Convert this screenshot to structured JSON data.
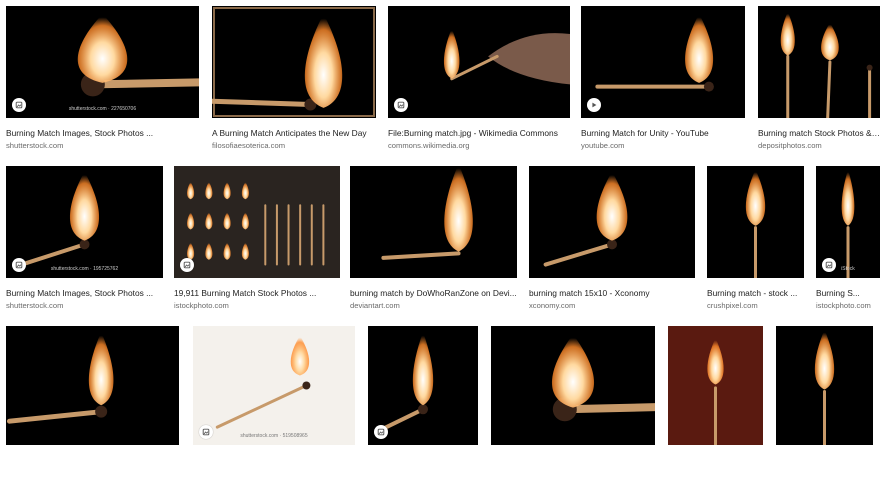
{
  "colors": {
    "flame_core": "#ffffff",
    "flame_mid": "#ffd9a0",
    "flame_outer": "#ff8a2a",
    "stick": "#c79a6a"
  },
  "results": [
    {
      "title": "Burning Match Images, Stock Photos ...",
      "source": "shutterstock.com",
      "watermark": "shutterstock.com · 227650706",
      "icon": "image-icon"
    },
    {
      "title": "A Burning Match Anticipates the New Day",
      "source": "filosofiaesoterica.com",
      "watermark": "",
      "icon": ""
    },
    {
      "title": "File:Burning match.jpg - Wikimedia Commons",
      "source": "commons.wikimedia.org",
      "watermark": "",
      "icon": "image-icon"
    },
    {
      "title": "Burning Match for Unity - YouTube",
      "source": "youtube.com",
      "watermark": "",
      "icon": "play-icon"
    },
    {
      "title": "Burning match Stock Photos & Im...",
      "source": "depositphotos.com",
      "watermark": "",
      "icon": ""
    },
    {
      "title": "Burning Match Images, Stock Photos ...",
      "source": "shutterstock.com",
      "watermark": "shutterstock.com · 195725762",
      "icon": "image-icon"
    },
    {
      "title": "19,911 Burning Match Stock Photos ...",
      "source": "istockphoto.com",
      "watermark": "",
      "icon": "image-icon"
    },
    {
      "title": "burning match by DoWhoRanZone on Devi...",
      "source": "deviantart.com",
      "watermark": "",
      "icon": ""
    },
    {
      "title": "burning match 15x10 - Xconomy",
      "source": "xconomy.com",
      "watermark": "",
      "icon": ""
    },
    {
      "title": "Burning match - stock ...",
      "source": "crushpixel.com",
      "watermark": "",
      "icon": ""
    },
    {
      "title": "Burning S...",
      "source": "istockphoto.com",
      "watermark": "iStock",
      "icon": "image-icon"
    },
    {
      "title": "",
      "source": "",
      "watermark": "",
      "icon": ""
    },
    {
      "title": "",
      "source": "",
      "watermark": "shutterstock.com · 519508965",
      "icon": "image-icon"
    },
    {
      "title": "",
      "source": "",
      "watermark": "",
      "icon": "image-icon"
    },
    {
      "title": "",
      "source": "",
      "watermark": "",
      "icon": ""
    },
    {
      "title": "",
      "source": "",
      "watermark": "",
      "icon": ""
    },
    {
      "title": "",
      "source": "",
      "watermark": "",
      "icon": ""
    }
  ]
}
